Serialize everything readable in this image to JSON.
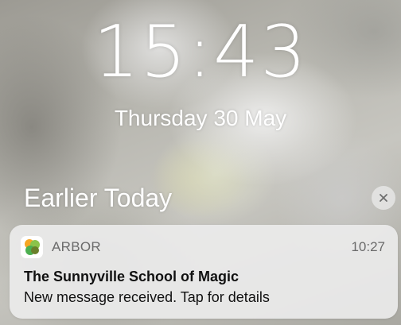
{
  "lock_screen": {
    "time": "15:43",
    "date": "Thursday 30 May"
  },
  "notification_center": {
    "section_title": "Earlier Today",
    "clear_button": {
      "icon": "close-icon"
    },
    "notifications": [
      {
        "app_icon": "arbor-app-icon",
        "app_name": "ARBOR",
        "time": "10:27",
        "title": "The Sunnyville School of Magic",
        "body": "New message received. Tap for details"
      }
    ]
  },
  "colors": {
    "text_primary": "#ffffff",
    "notif_background": "#ececec",
    "arbor_orange": "#f5a623",
    "arbor_green": "#4caf50",
    "arbor_green_light": "#8bc34a",
    "arbor_olive": "#6a7f2a"
  }
}
